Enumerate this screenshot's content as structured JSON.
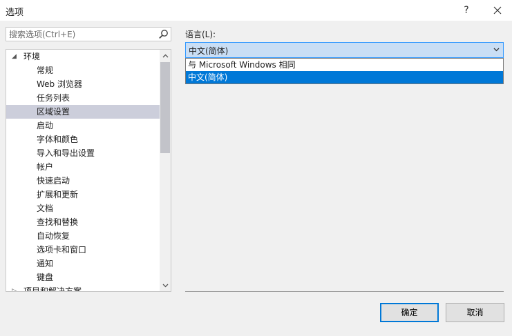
{
  "window": {
    "title": "选项",
    "help_label": "?"
  },
  "search": {
    "placeholder": "搜索选项(Ctrl+E)"
  },
  "tree": {
    "root": "环境",
    "children": [
      "常规",
      "Web 浏览器",
      "任务列表",
      "区域设置",
      "启动",
      "字体和颜色",
      "导入和导出设置",
      "帐户",
      "快速启动",
      "扩展和更新",
      "文档",
      "查找和替换",
      "自动恢复",
      "选项卡和窗口",
      "通知",
      "键盘"
    ],
    "next_root": "项目和解决方案",
    "selected": "区域设置"
  },
  "language": {
    "label": "语言(L):",
    "selected": "中文(简体)",
    "options": [
      "与 Microsoft Windows 相同",
      "中文(简体)"
    ]
  },
  "buttons": {
    "ok": "确定",
    "cancel": "取消"
  },
  "colors": {
    "accent": "#0078d7",
    "selection": "#cccedb",
    "select_bg": "#c9def5"
  }
}
